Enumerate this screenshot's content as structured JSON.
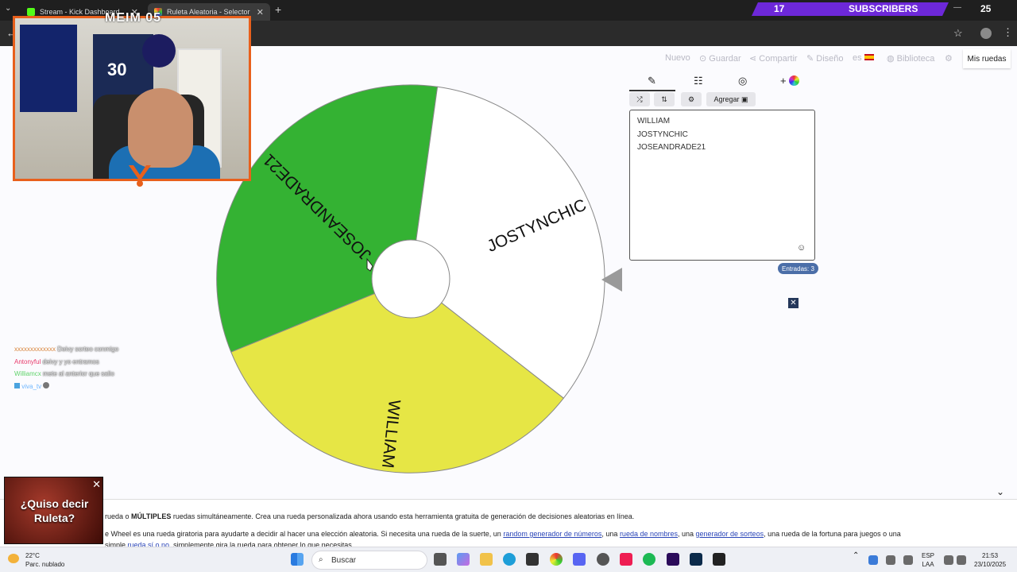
{
  "browser": {
    "tabs": [
      {
        "label": "Stream - Kick Dashboard",
        "color": "#53fc18"
      },
      {
        "label": "Ruleta Aleatoria - Selector Pers",
        "color": "#d946ef"
      }
    ],
    "new_tab": "+",
    "tab_close": "✕"
  },
  "stream_overlay": {
    "subs_count": "17",
    "subs_label": "SUBSCRIBERS",
    "subs_goal": "25",
    "cam_name": "MEIM 05",
    "jersey_number": "30",
    "chat": [
      {
        "user": "xxxxxxxxxxxxx",
        "user_color": "#d9843b",
        "text": "Deivy sorteo conmigo"
      },
      {
        "user": "Antonyful",
        "user_color": "#e83a6b",
        "text": "deivy y yo entramos"
      },
      {
        "user": "Williamcx",
        "user_color": "#5fd36a",
        "text": "mete al anterior que salio"
      },
      {
        "user": "viva_tv",
        "user_color": "#6fb6ff",
        "text": ""
      }
    ],
    "popup_text": "¿Quiso decir Ruleta?",
    "popup_close": "✕"
  },
  "site_nav": {
    "items": [
      "Nuevo",
      "Guardar",
      "Compartir",
      "Diseño",
      "es",
      "Biblioteca"
    ],
    "my_wheels": "Mis ruedas"
  },
  "wheel": {
    "segments": [
      {
        "label": "JOSEANDRADE21",
        "color": "#34b233"
      },
      {
        "label": "JOSTYNCHIC",
        "color": "#ffffff"
      },
      {
        "label": "WILLIAM",
        "color": "#e6e645"
      }
    ]
  },
  "editor": {
    "tabs": [
      "edit-icon",
      "list-icon",
      "hide-icon",
      "add-color-icon"
    ],
    "toolbar": {
      "add_label": "Agregar"
    },
    "entries": [
      "WILLIAM",
      "JOSTYNCHIC",
      "JOSEANDRADE21"
    ],
    "count_label": "Entradas: 3",
    "close": "✕"
  },
  "page_text": {
    "line1_pre": "rueda o ",
    "line1_bold": "MÚLTIPLES",
    "line1_post": " ruedas simultáneamente. Crea una rueda personalizada ahora usando esta herramienta gratuita de generación de decisiones aleatorias en línea.",
    "line2_a": "e Wheel es una rueda giratoria para ayudarte a decidir al hacer una elección aleatoria. Si necesita una rueda de la suerte, un ",
    "link1": "random generador de números",
    "line2_b": ", una ",
    "link2": "rueda de nombres",
    "line2_c": ", una ",
    "link3": "generador de sorteos",
    "line2_d": ", una rueda de la fortuna para juegos o una",
    "line3_a": "simple ",
    "link4": "rueda sí o no",
    "line3_b": ", simplemente gira la rueda para obtener lo que necesitas."
  },
  "taskbar": {
    "temp": "22°C",
    "weather": "Parc. nublado",
    "search": "Buscar",
    "lang1": "ESP",
    "lang2": "LAA",
    "time": "21:53",
    "date": "23/10/2025"
  }
}
